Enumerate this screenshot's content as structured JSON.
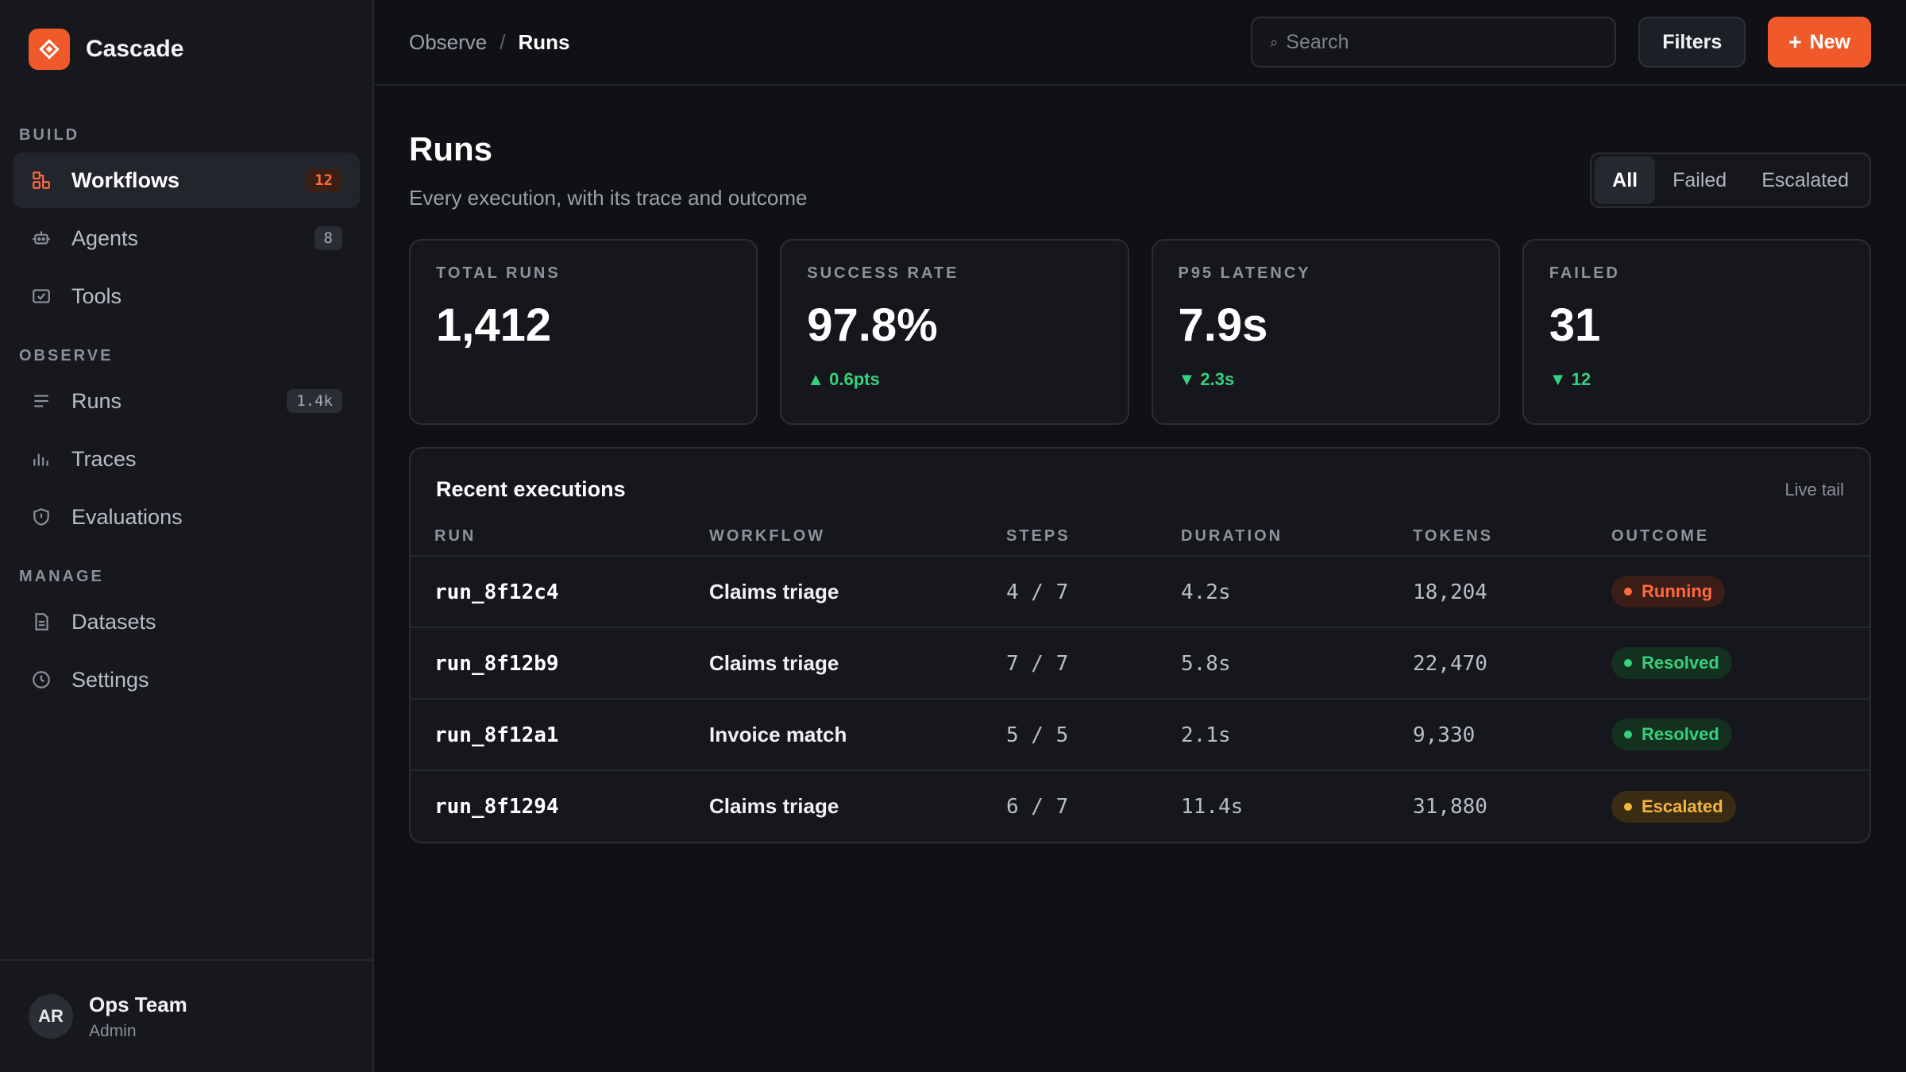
{
  "app": {
    "name": "Cascade"
  },
  "sidebar": {
    "sections": [
      {
        "label": "BUILD",
        "items": [
          {
            "key": "workflows",
            "label": "Workflows",
            "badge": "12",
            "active": true,
            "icon": "workflow-icon"
          },
          {
            "key": "agents",
            "label": "Agents",
            "badge": "8",
            "active": false,
            "icon": "agent-icon"
          },
          {
            "key": "tools",
            "label": "Tools",
            "badge": "",
            "active": false,
            "icon": "tools-icon"
          }
        ]
      },
      {
        "label": "OBSERVE",
        "items": [
          {
            "key": "runs",
            "label": "Runs",
            "badge": "1.4k",
            "active": false,
            "icon": "list-icon"
          },
          {
            "key": "traces",
            "label": "Traces",
            "badge": "",
            "active": false,
            "icon": "bar-chart-icon"
          },
          {
            "key": "evaluations",
            "label": "Evaluations",
            "badge": "",
            "active": false,
            "icon": "shield-icon"
          }
        ]
      },
      {
        "label": "MANAGE",
        "items": [
          {
            "key": "datasets",
            "label": "Datasets",
            "badge": "",
            "active": false,
            "icon": "document-icon"
          },
          {
            "key": "settings",
            "label": "Settings",
            "badge": "",
            "active": false,
            "icon": "clock-icon"
          }
        ]
      }
    ],
    "user": {
      "initials": "AR",
      "name": "Ops Team",
      "role": "Admin"
    }
  },
  "topbar": {
    "breadcrumb_parent": "Observe",
    "breadcrumb_sep": "/",
    "breadcrumb_current": "Runs",
    "search_placeholder": "Search",
    "filters_label": "Filters",
    "new_label": "New"
  },
  "page": {
    "title": "Runs",
    "subtitle": "Every execution, with its trace and outcome",
    "segments": [
      {
        "label": "All",
        "active": true
      },
      {
        "label": "Failed",
        "active": false
      },
      {
        "label": "Escalated",
        "active": false
      }
    ]
  },
  "stats": [
    {
      "label": "TOTAL RUNS",
      "value": "1,412",
      "delta": ""
    },
    {
      "label": "SUCCESS RATE",
      "value": "97.8%",
      "delta": "▲ 0.6pts"
    },
    {
      "label": "P95 LATENCY",
      "value": "7.9s",
      "delta": "▼ 2.3s"
    },
    {
      "label": "FAILED",
      "value": "31",
      "delta": "▼ 12"
    }
  ],
  "table": {
    "title": "Recent executions",
    "hint": "Live tail",
    "columns": [
      "RUN",
      "WORKFLOW",
      "STEPS",
      "DURATION",
      "TOKENS",
      "OUTCOME"
    ],
    "rows": [
      {
        "run": "run_8f12c4",
        "workflow": "Claims triage",
        "steps": "4 / 7",
        "duration": "4.2s",
        "tokens": "18,204",
        "outcome": "Running",
        "status": "running"
      },
      {
        "run": "run_8f12b9",
        "workflow": "Claims triage",
        "steps": "7 / 7",
        "duration": "5.8s",
        "tokens": "22,470",
        "outcome": "Resolved",
        "status": "resolved"
      },
      {
        "run": "run_8f12a1",
        "workflow": "Invoice match",
        "steps": "5 / 5",
        "duration": "2.1s",
        "tokens": "9,330",
        "outcome": "Resolved",
        "status": "resolved"
      },
      {
        "run": "run_8f1294",
        "workflow": "Claims triage",
        "steps": "6 / 7",
        "duration": "11.4s",
        "tokens": "31,880",
        "outcome": "Escalated",
        "status": "escalated"
      }
    ]
  },
  "colors": {
    "accent": "#f05a2a",
    "running_fg": "#ff6a3d",
    "running_bg": "#3a1d16",
    "resolved_fg": "#34d17f",
    "resolved_bg": "#14301f",
    "escalated_fg": "#f5b53a",
    "escalated_bg": "#3a2c12"
  }
}
